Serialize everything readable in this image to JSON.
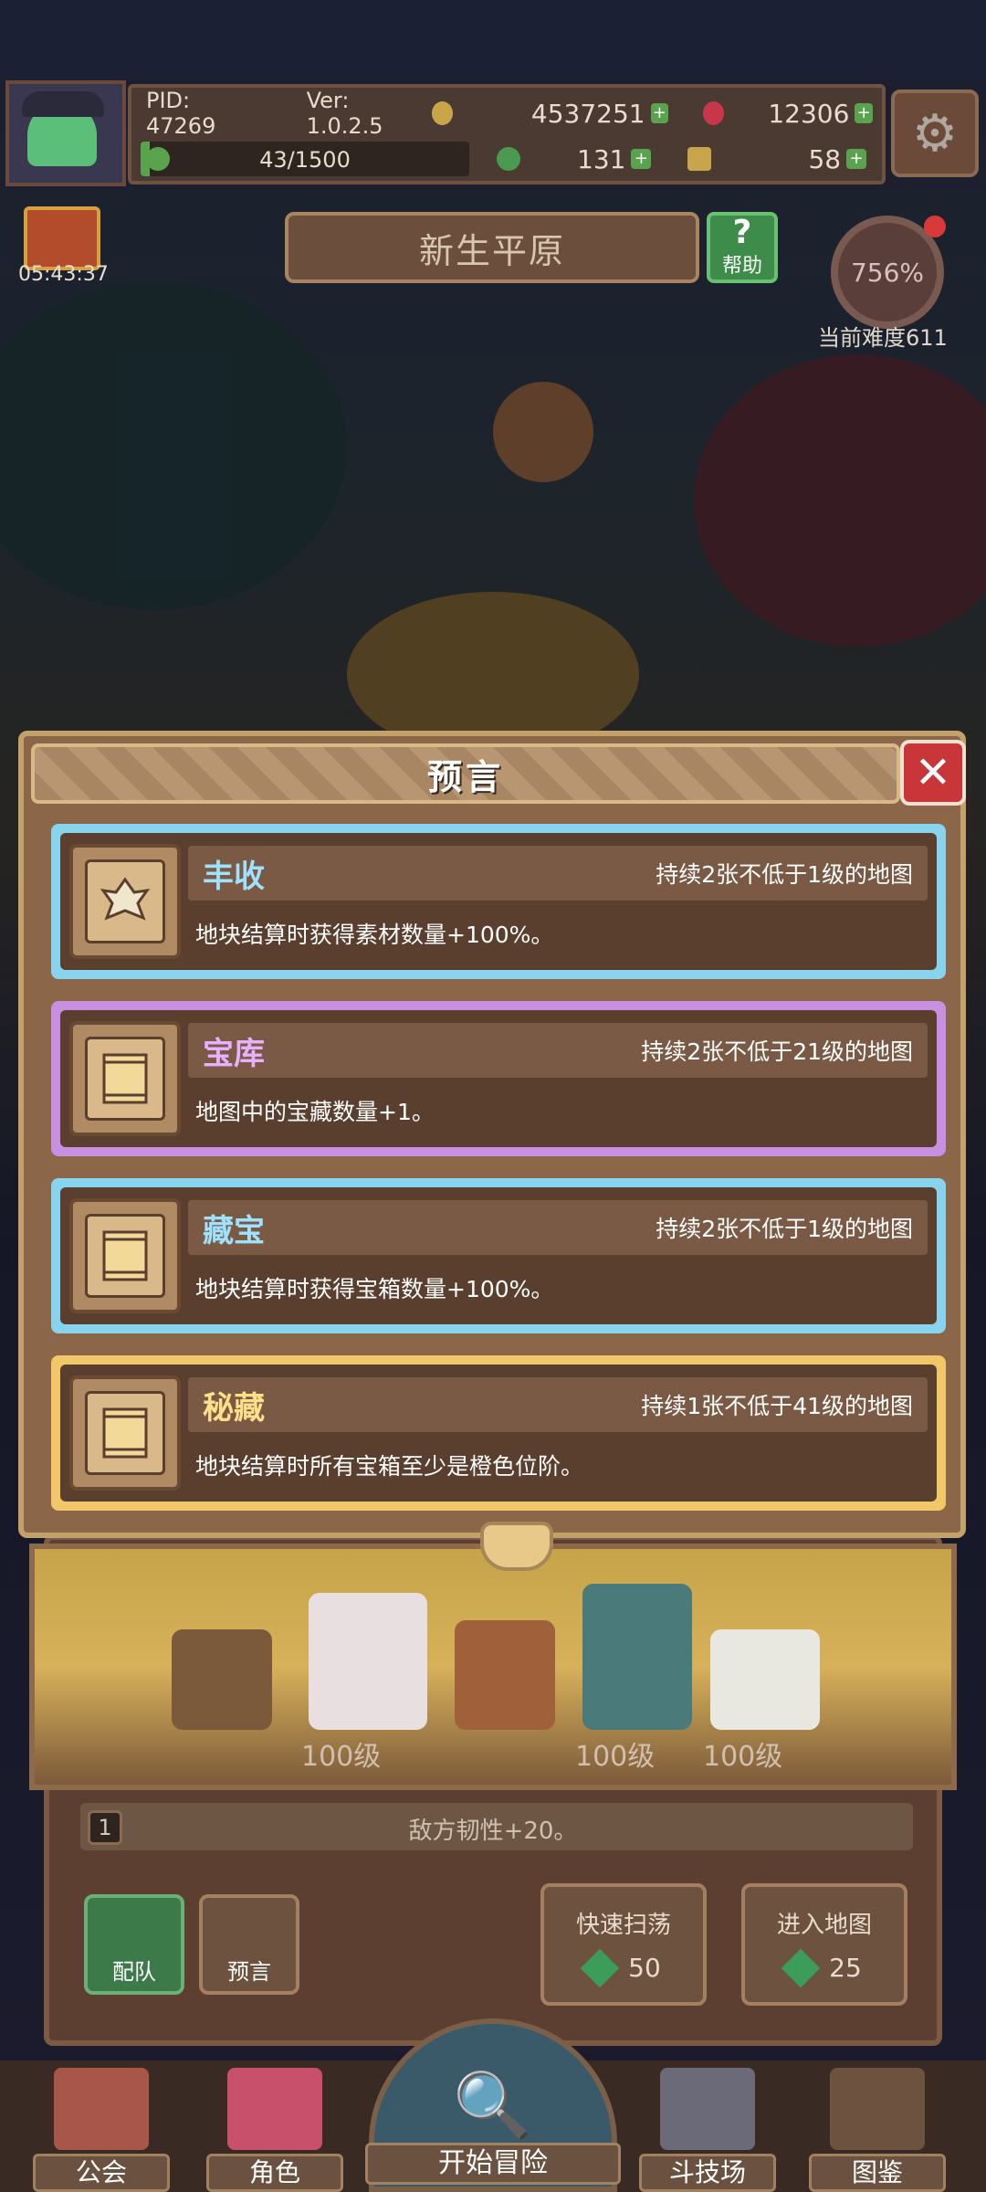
{
  "hud": {
    "pid": "PID: 47269",
    "version": "Ver: 1.0.2.5",
    "gold": "4537251",
    "gems": "12306",
    "stamina": "43/1500",
    "stamina_fraction": 0.0287,
    "clover": "131",
    "material": "58",
    "gift_timer": "05:43:37",
    "area_name": "新生平原",
    "help_label": "帮助",
    "difficulty_pct": "756%",
    "difficulty_label": "当前难度611"
  },
  "modal": {
    "title": "预言",
    "close_icon": "close-icon",
    "cards": [
      {
        "name": "丰收",
        "duration": "持续2张不低于1级的地图",
        "desc": "地块结算时获得素材数量+100%。",
        "tier": "blue",
        "color": "#88d3ee",
        "icon": "harvest-icon"
      },
      {
        "name": "宝库",
        "duration": "持续2张不低于21级的地图",
        "desc": "地图中的宝藏数量+1。",
        "tier": "purple",
        "color": "#c98fe0",
        "icon": "scroll-icon"
      },
      {
        "name": "藏宝",
        "duration": "持续2张不低于1级的地图",
        "desc": "地块结算时获得宝箱数量+100%。",
        "tier": "blue",
        "color": "#88d3ee",
        "icon": "scroll-icon"
      },
      {
        "name": "秘藏",
        "duration": "持续1张不低于41级的地图",
        "desc": "地块结算时所有宝箱至少是橙色位阶。",
        "tier": "orange",
        "color": "#f0c86a",
        "icon": "scroll-icon"
      }
    ]
  },
  "stage": {
    "level_left": "100级",
    "level_mid": "100级",
    "level_right": "100级",
    "effect_index": "1",
    "effect_text": "敌方韧性+20。"
  },
  "actions": {
    "team_label": "配队",
    "prophecy_label": "预言",
    "quick_sweep_label": "快速扫荡",
    "quick_sweep_cost": "50",
    "enter_map_label": "进入地图",
    "enter_map_cost": "25"
  },
  "nav": {
    "guild": "公会",
    "character": "角色",
    "start": "开始冒险",
    "arena": "斗技场",
    "codex": "图鉴"
  }
}
